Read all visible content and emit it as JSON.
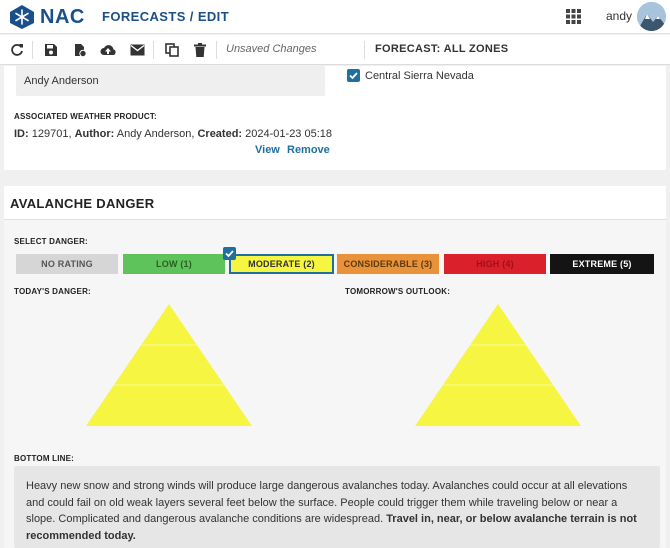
{
  "app": {
    "logo_text": "NAC",
    "nav_section": "FORECASTS",
    "nav_separator": "/",
    "nav_subsection": "EDIT",
    "user_name": "andy"
  },
  "toolbar": {
    "icons": [
      "refresh-icon",
      "save-icon",
      "save-copy-icon",
      "cloud-upload-icon",
      "mail-icon",
      "copy-icon",
      "trash-icon"
    ],
    "status_text": "Unsaved Changes",
    "forecast_scope": "FORECAST: ALL ZONES"
  },
  "forecast_meta": {
    "author_name": "Andy Anderson",
    "zones": [
      {
        "label": "Central Sierra Nevada",
        "checked": true
      }
    ],
    "associated_label": "ASSOCIATED WEATHER PRODUCT:",
    "id_label": "ID:",
    "id_value": "129701,",
    "author_label": "Author:",
    "author_value": "Andy Anderson,",
    "created_label": "Created:",
    "created_value": "2024-01-23 05:18",
    "view_link": "View",
    "remove_link": "Remove"
  },
  "avalanche": {
    "section_title": "AVALANCHE DANGER",
    "select_label": "SELECT DANGER:",
    "levels": [
      {
        "label": "NO RATING",
        "color": "#d6d6d6"
      },
      {
        "label": "LOW (1)",
        "color": "#5ec35a"
      },
      {
        "label": "MODERATE (2)",
        "color": "#f5f542",
        "selected": true
      },
      {
        "label": "CONSIDERABLE (3)",
        "color": "#e8923a"
      },
      {
        "label": "HIGH (4)",
        "color": "#d9202b"
      },
      {
        "label": "EXTREME (5)",
        "color": "#141414"
      }
    ],
    "today_label": "TODAY'S DANGER:",
    "tomorrow_label": "TOMORROW'S OUTLOOK:",
    "pyramid_color": "#f5f542",
    "bottom_line_label": "BOTTOM LINE:",
    "bottom_line_text": "Heavy new snow and strong winds will produce large dangerous avalanches today. Avalanches could occur at all elevations and could fail on old weak layers several feet below the surface. People could trigger them while traveling below or near a slope. Complicated and dangerous avalanche conditions are widespread.",
    "bottom_line_emphasis": "Travel in, near, or below avalanche terrain is not recommended today."
  }
}
